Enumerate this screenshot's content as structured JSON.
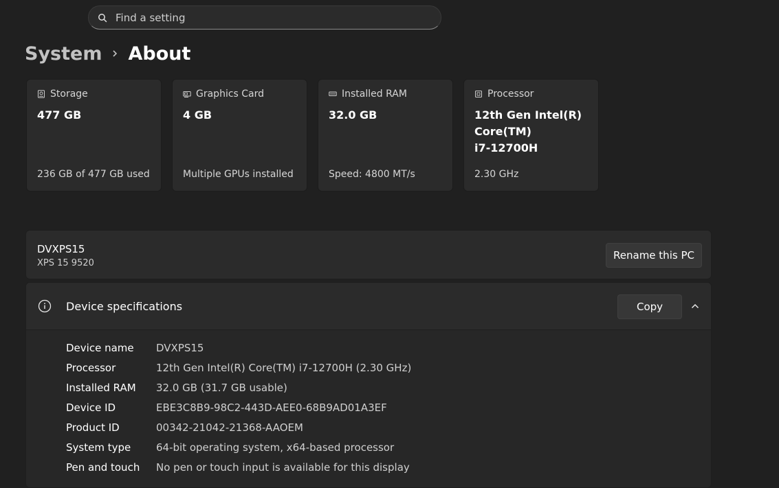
{
  "search": {
    "placeholder": "Find a setting"
  },
  "breadcrumb": {
    "parent": "System",
    "current": "About"
  },
  "cards": [
    {
      "title": "Storage",
      "value_lines": [
        "477 GB"
      ],
      "sub": "236 GB of 477 GB used",
      "icon": "storage-icon"
    },
    {
      "title": "Graphics Card",
      "value_lines": [
        "4 GB"
      ],
      "sub": "Multiple GPUs installed",
      "icon": "graphics-card-icon"
    },
    {
      "title": "Installed RAM",
      "value_lines": [
        "32.0 GB"
      ],
      "sub": "Speed: 4800 MT/s",
      "icon": "ram-icon"
    },
    {
      "title": "Processor",
      "value_lines": [
        "12th Gen Intel(R)",
        "Core(TM)",
        "i7-12700H"
      ],
      "sub": "2.30 GHz",
      "icon": "processor-icon"
    }
  ],
  "pc": {
    "name": "DVXPS15",
    "model": "XPS 15 9520",
    "rename_label": "Rename this PC"
  },
  "specs": {
    "title": "Device specifications",
    "copy_label": "Copy",
    "rows": [
      {
        "key": "Device name",
        "value": "DVXPS15"
      },
      {
        "key": "Processor",
        "value": "12th Gen Intel(R) Core(TM) i7-12700H (2.30 GHz)"
      },
      {
        "key": "Installed RAM",
        "value": "32.0 GB (31.7 GB usable)"
      },
      {
        "key": "Device ID",
        "value": "EBE3C8B9-98C2-443D-AEE0-68B9AD01A3EF"
      },
      {
        "key": "Product ID",
        "value": "00342-21042-21368-AAOEM"
      },
      {
        "key": "System type",
        "value": "64-bit operating system, x64-based processor"
      },
      {
        "key": "Pen and touch",
        "value": "No pen or touch input is available for this display"
      }
    ]
  },
  "colors": {
    "background": "#202020",
    "card": "#2b2b2b",
    "text_secondary": "#cfcfcf"
  }
}
